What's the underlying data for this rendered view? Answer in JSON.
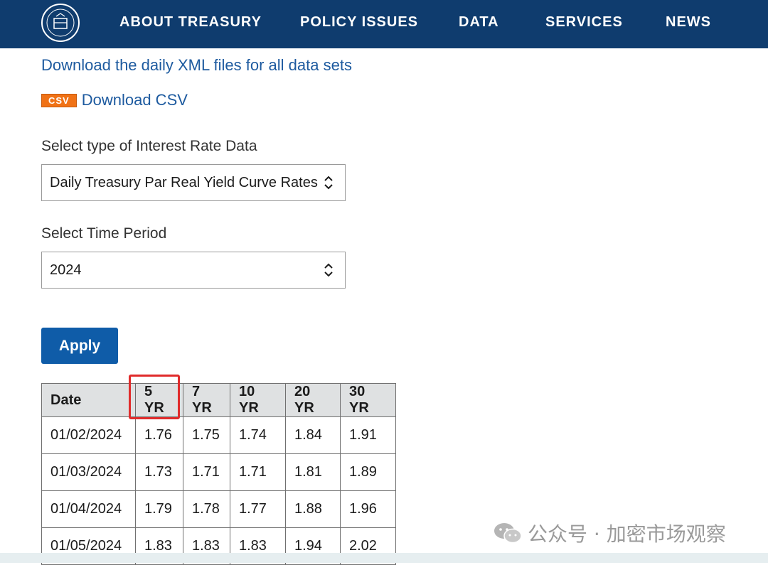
{
  "nav": {
    "items": [
      "ABOUT TREASURY",
      "POLICY ISSUES",
      "DATA",
      "SERVICES",
      "NEWS"
    ]
  },
  "links": {
    "xml": "Download the daily XML files for all data sets",
    "csv_badge": "CSV",
    "csv": "Download CSV"
  },
  "form": {
    "type_label": "Select type of Interest Rate Data",
    "type_value": "Daily Treasury Par Real Yield Curve Rates",
    "period_label": "Select Time Period",
    "period_value": "2024",
    "apply_label": "Apply"
  },
  "table": {
    "headers": [
      "Date",
      "5 YR",
      "7 YR",
      "10 YR",
      "20 YR",
      "30 YR"
    ],
    "rows": [
      [
        "01/02/2024",
        "1.76",
        "1.75",
        "1.74",
        "1.84",
        "1.91"
      ],
      [
        "01/03/2024",
        "1.73",
        "1.71",
        "1.71",
        "1.81",
        "1.89"
      ],
      [
        "01/04/2024",
        "1.79",
        "1.78",
        "1.77",
        "1.88",
        "1.96"
      ],
      [
        "01/05/2024",
        "1.83",
        "1.83",
        "1.83",
        "1.94",
        "2.02"
      ]
    ]
  },
  "watermark": {
    "text": "公众号 · 加密市场观察"
  },
  "colors": {
    "nav_bg": "#0f3c6e",
    "link": "#1d5a9f",
    "apply_bg": "#0f5ca8",
    "highlight": "#e02b2b",
    "csv_badge": "#f07216"
  }
}
